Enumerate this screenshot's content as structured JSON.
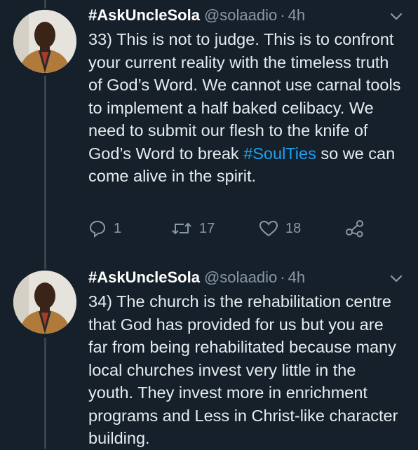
{
  "colors": {
    "background": "#15202b",
    "text": "#e6ecf0",
    "muted": "#8899a6",
    "link": "#1da1f2",
    "thread_line": "#38444d"
  },
  "tweets": [
    {
      "display_name": "#AskUncleSola",
      "handle": "@solaadio",
      "separator": "·",
      "time": "4h",
      "text_before": "33) This is not to judge. This is to confront your current reality with the timeless truth of God’s Word. We cannot use carnal tools to implement a half baked celibacy. We need to submit our flesh to the knife of God’s Word to break ",
      "hashtag": "#SoulTies",
      "text_after": " so we can come alive in the spirit.",
      "replies": "1",
      "retweets": "17",
      "likes": "18",
      "icons": [
        "reply-icon",
        "retweet-icon",
        "like-icon",
        "share-icon",
        "chevron-down-icon"
      ]
    },
    {
      "display_name": "#AskUncleSola",
      "handle": "@solaadio",
      "separator": "·",
      "time": "4h",
      "text": "34) The church is the rehabilitation centre that God has provided for us but you are far from being rehabilitated because many local churches invest very little in the youth. They invest more in enrichment programs and Less in Christ-like character building.",
      "icons": [
        "chevron-down-icon"
      ]
    }
  ]
}
